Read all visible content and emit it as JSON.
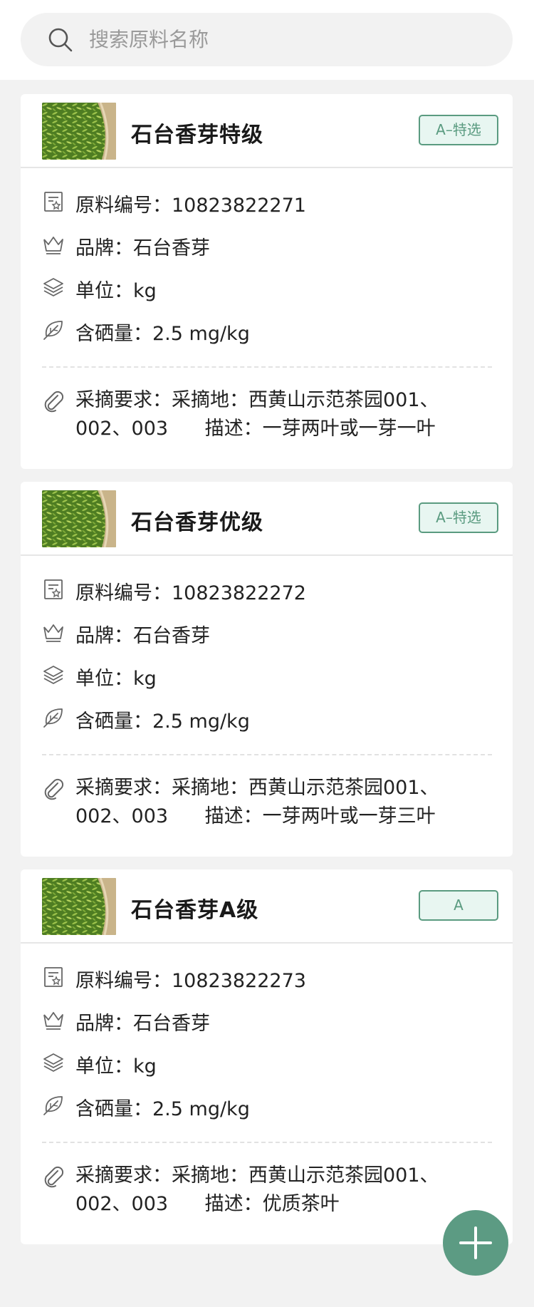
{
  "search": {
    "placeholder": "搜索原料名称"
  },
  "cards": [
    {
      "title": "石台香芽特级",
      "grade": "A–特选",
      "code_label": "原料编号：",
      "code": "10823822271",
      "brand_label": "品牌：",
      "brand": "石台香芽",
      "unit_label": "单位：",
      "unit": "kg",
      "se_label": "含硒量：",
      "se": "2.5 mg/kg",
      "pick_label": "采摘要求：",
      "pick_place": "采摘地：西黄山示范茶园001、002、003",
      "pick_desc": "描述：一芽两叶或一芽一叶"
    },
    {
      "title": "石台香芽优级",
      "grade": "A–特选",
      "code_label": "原料编号：",
      "code": "10823822272",
      "brand_label": "品牌：",
      "brand": "石台香芽",
      "unit_label": "单位：",
      "unit": "kg",
      "se_label": "含硒量：",
      "se": "2.5 mg/kg",
      "pick_label": "采摘要求：",
      "pick_place": "采摘地：西黄山示范茶园001、002、003",
      "pick_desc": "描述：一芽两叶或一芽三叶"
    },
    {
      "title": "石台香芽A级",
      "grade": "A",
      "code_label": "原料编号：",
      "code": "10823822273",
      "brand_label": "品牌：",
      "brand": "石台香芽",
      "unit_label": "单位：",
      "unit": "kg",
      "se_label": "含硒量：",
      "se": "2.5 mg/kg",
      "pick_label": "采摘要求：",
      "pick_place": "采摘地：西黄山示范茶园001、002、003",
      "pick_desc": "描述：优质茶叶"
    }
  ],
  "colors": {
    "accent": "#5c9b83",
    "badge_bg": "#e8f6f1",
    "page_bg": "#f2f2f2"
  },
  "icons": [
    "search-icon",
    "document-icon",
    "crown-icon",
    "layers-icon",
    "leaf-icon",
    "paperclip-icon",
    "plus-icon"
  ]
}
